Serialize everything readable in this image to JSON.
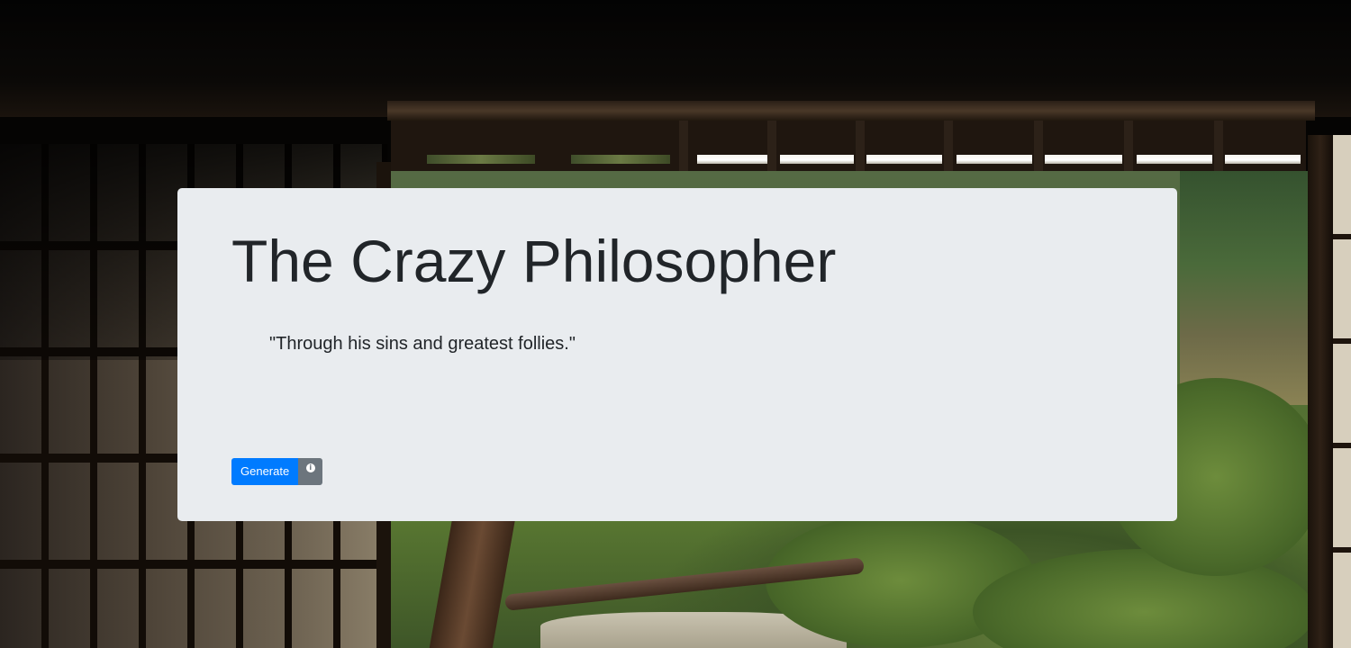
{
  "jumbotron": {
    "title": "The Crazy Philosopher",
    "quote": "\"Through his sins and greatest follies.\""
  },
  "actions": {
    "generate_label": "Generate",
    "info_icon": "info-circle-icon"
  },
  "background": {
    "description_icon": "japanese-temple-garden-photo"
  },
  "colors": {
    "card_background": "#e9ecef",
    "primary_button": "#007bff",
    "secondary_button": "#6c757d",
    "text": "#212529"
  }
}
